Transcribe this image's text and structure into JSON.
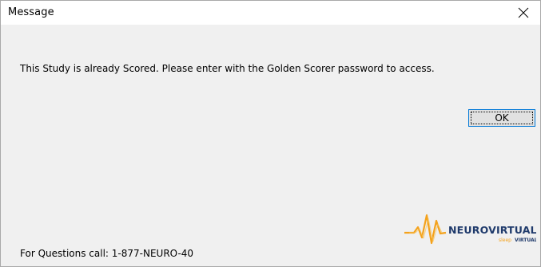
{
  "window": {
    "title": "Message"
  },
  "message": {
    "text": "This Study is already Scored. Please enter with the Golden Scorer password to access."
  },
  "buttons": {
    "ok_label": "OK"
  },
  "footer": {
    "text": "For Questions call: 1-877-NEURO-40"
  },
  "logo": {
    "name": "NEUROVIRTUAL",
    "tagline": "sleep virtual"
  },
  "colors": {
    "accent_blue": "#0078d7",
    "logo_orange": "#f4a21c",
    "logo_navy": "#1f3a6b",
    "dialog_bg": "#f0f0f0"
  },
  "icons": {
    "close": "close-icon"
  }
}
